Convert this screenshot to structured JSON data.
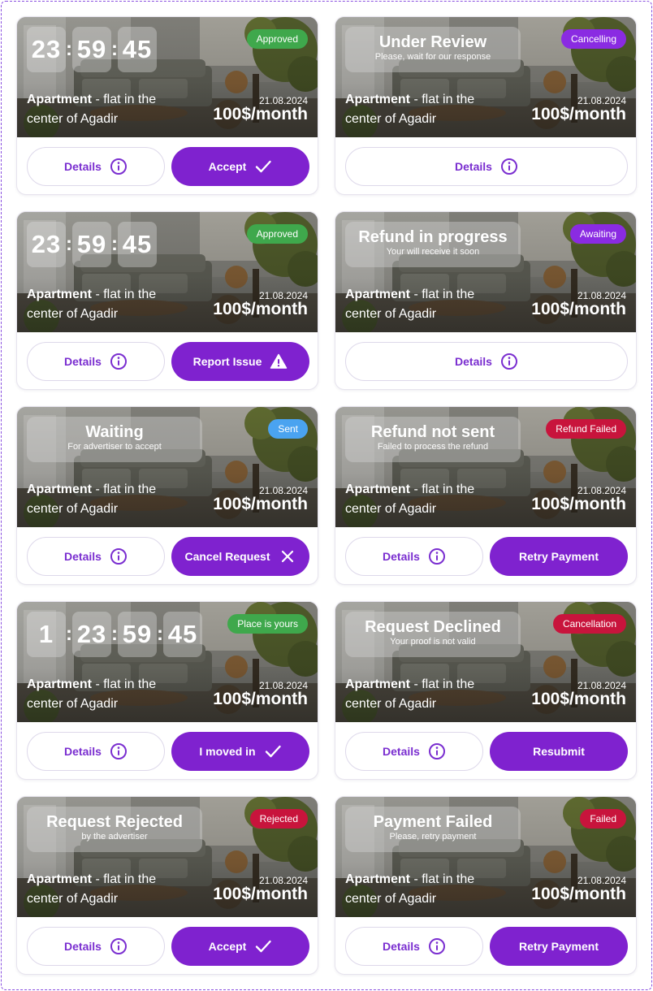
{
  "colors": {
    "accent": "#7f22cf",
    "approved": "#3fa84c",
    "purple_badge": "#8a2be2",
    "sent": "#4aa3f0",
    "failed": "#c8143c"
  },
  "common": {
    "title_bold": "Apartment",
    "title_rest": " - flat in the center of Agadir",
    "date": "21.08.2024",
    "price": "100$/month",
    "details_label": "Details"
  },
  "cards": [
    {
      "badge": "Approved",
      "badge_color": "#3fa84c",
      "timer": [
        "23",
        "59",
        "45"
      ],
      "primary": {
        "label": "Accept",
        "icon": "check-icon"
      }
    },
    {
      "badge": "Cancelling",
      "badge_color": "#8a2be2",
      "status_title": "Under Review",
      "status_sub": "Please, wait for our response"
    },
    {
      "badge": "Approved",
      "badge_color": "#3fa84c",
      "timer": [
        "23",
        "59",
        "45"
      ],
      "primary": {
        "label": "Report Issue",
        "icon": "warning-icon"
      }
    },
    {
      "badge": "Awaiting",
      "badge_color": "#8a2be2",
      "status_title": "Refund in progress",
      "status_sub": "Your will receive it soon"
    },
    {
      "badge": "Sent",
      "badge_color": "#4aa3f0",
      "status_title": "Waiting",
      "status_sub": "For advertiser to accept",
      "primary": {
        "label": "Cancel Request",
        "icon": "close-icon"
      }
    },
    {
      "badge": "Refund Failed",
      "badge_color": "#c8143c",
      "status_title": "Refund not sent",
      "status_sub": "Failed to process the refund",
      "primary": {
        "label": "Retry Payment",
        "icon": ""
      }
    },
    {
      "badge": "Place is yours",
      "badge_color": "#3fa84c",
      "timer": [
        "1",
        "23",
        "59",
        "45"
      ],
      "primary": {
        "label": "I moved in",
        "icon": "check-icon"
      }
    },
    {
      "badge": "Cancellation",
      "badge_color": "#c8143c",
      "status_title": "Request Declined",
      "status_sub": "Your proof is not valid",
      "primary": {
        "label": "Resubmit",
        "icon": ""
      }
    },
    {
      "badge": "Rejected",
      "badge_color": "#c8143c",
      "status_title": "Request Rejected",
      "status_sub": "by the advertiser",
      "primary": {
        "label": "Accept",
        "icon": "check-icon"
      }
    },
    {
      "badge": "Failed",
      "badge_color": "#c8143c",
      "status_title": "Payment Failed",
      "status_sub": "Please, retry payment",
      "primary": {
        "label": "Retry Payment",
        "icon": ""
      }
    }
  ]
}
